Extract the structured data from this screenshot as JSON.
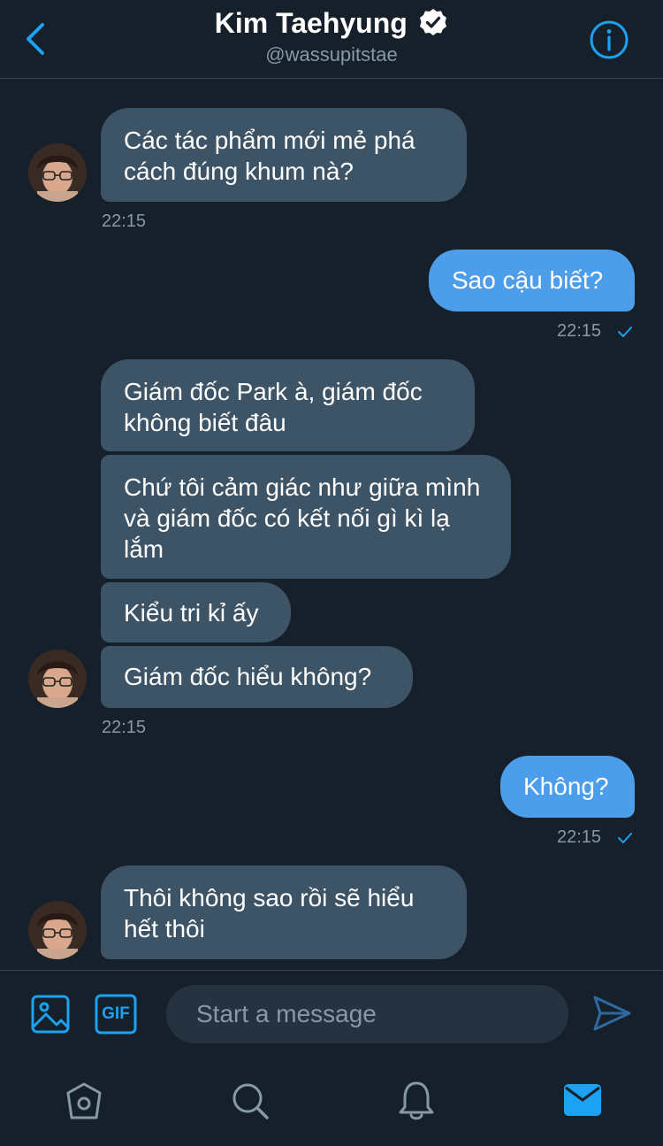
{
  "header": {
    "title": "Kim Taehyung",
    "handle": "@wassupitstae",
    "back_icon": "chevron-left-icon",
    "verified_icon": "verified-badge-icon",
    "info_icon": "info-icon"
  },
  "messages": [
    {
      "direction": "incoming",
      "text": "Các tác phẩm mới mẻ phá cách đúng khum nà?"
    },
    {
      "direction": "incoming_time",
      "text": "22:15"
    },
    {
      "direction": "outgoing",
      "text": "Sao cậu biết?"
    },
    {
      "direction": "outgoing_time",
      "text": "22:15"
    },
    {
      "direction": "incoming",
      "text": "Giám đốc Park à, giám đốc không biết đâu"
    },
    {
      "direction": "incoming",
      "text": "Chứ tôi cảm giác như giữa mình và giám đốc có kết nối gì kì lạ lắm"
    },
    {
      "direction": "incoming",
      "text": "Kiểu tri kỉ ấy"
    },
    {
      "direction": "incoming",
      "text": "Giám đốc hiểu không?"
    },
    {
      "direction": "incoming_time",
      "text": "22:15"
    },
    {
      "direction": "outgoing",
      "text": "Không?"
    },
    {
      "direction": "outgoing_time",
      "text": "22:15"
    },
    {
      "direction": "incoming",
      "text": "Thôi không sao rồi sẽ hiểu hết thôi"
    }
  ],
  "composer": {
    "placeholder": "Start a message",
    "media_icon": "image-icon",
    "gif_icon": "gif-icon",
    "gif_label": "GIF",
    "send_icon": "send-icon"
  },
  "tabbar": {
    "home_icon": "home-icon",
    "search_icon": "search-icon",
    "notifications_icon": "bell-icon",
    "messages_icon": "mail-icon"
  },
  "colors": {
    "background": "#15202b",
    "incoming_bubble": "#3d5466",
    "outgoing_bubble": "#4c9eeb",
    "accent": "#1da1f2",
    "muted_text": "#8899a6",
    "divider": "#38444d"
  }
}
